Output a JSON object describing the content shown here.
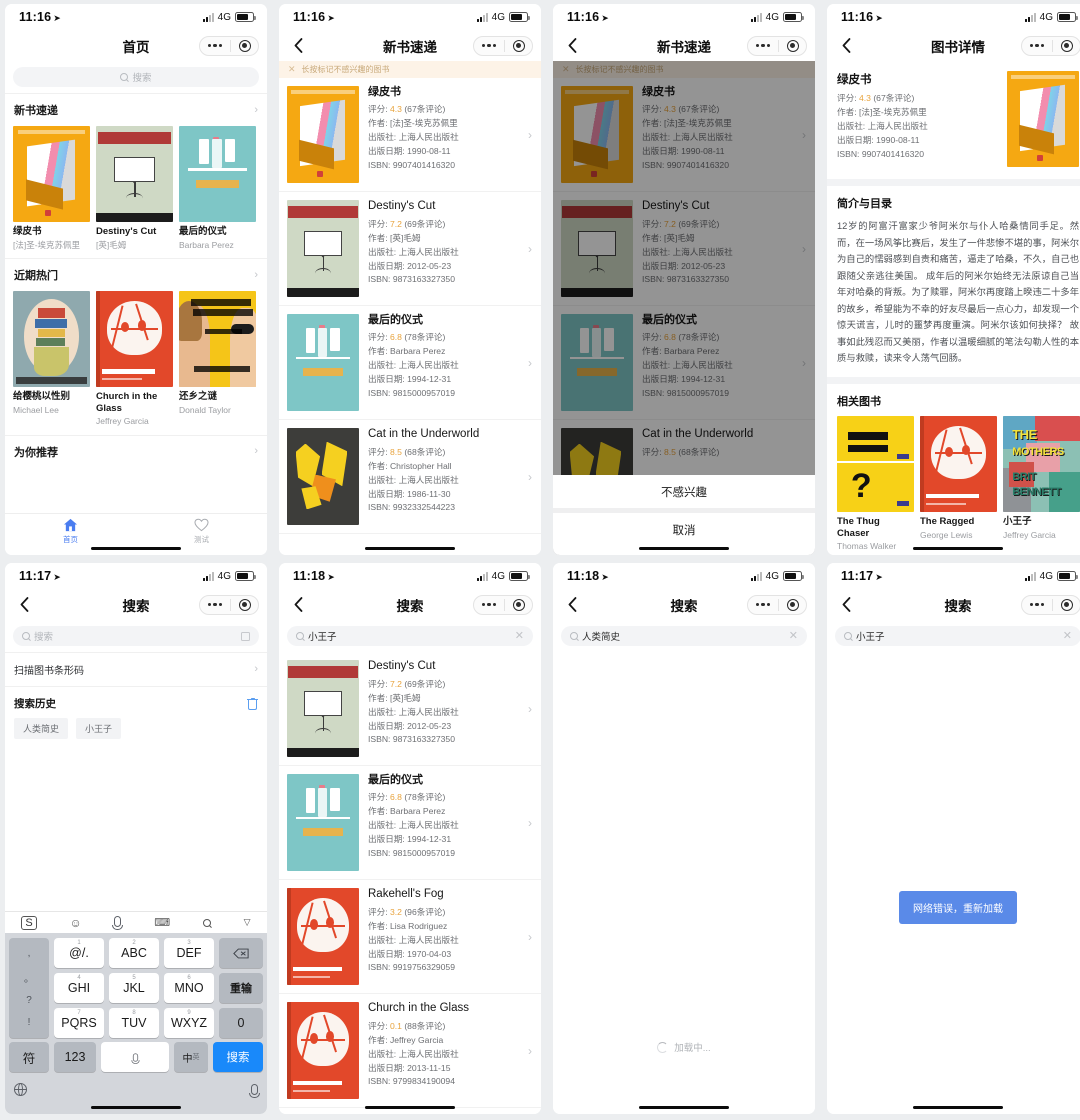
{
  "common": {
    "carrier_net": "4G",
    "nav_more_icon": "more-dots-icon",
    "nav_target_icon": "target-circle-icon",
    "back_icon": "back-chevron-icon",
    "chevron_right": "›",
    "publisher_label": "出版社:",
    "author_label": "作者:",
    "date_label": "出版日期:",
    "isbn_label": "ISBN:",
    "rating_label": "评分:",
    "accent_blue": "#1989fa",
    "rating_orange": "#e8a33d"
  },
  "panels": {
    "home": {
      "time": "11:16",
      "title": "首页",
      "search_placeholder": "搜索",
      "sections": [
        {
          "title": "新书速递"
        },
        {
          "title": "近期热门"
        },
        {
          "title": "为你推荐"
        }
      ],
      "new_books": [
        {
          "title": "绿皮书",
          "author": "[法]圣-埃克苏佩里",
          "cover": "cv-green"
        },
        {
          "title": "Destiny's Cut",
          "author": "[英]毛姆",
          "cover": "cv-destiny"
        },
        {
          "title": "最后的仪式",
          "author": "Barbara Perez",
          "cover": "cv-last"
        }
      ],
      "hot_books": [
        {
          "title": "给樱桃以性别",
          "author": "Michael Lee",
          "cover": "cv-cherry"
        },
        {
          "title": "Church in the Glass",
          "author": "Jeffrey Garcia",
          "cover": "cv-red"
        },
        {
          "title": "还乡之谜",
          "author": "Donald Taylor",
          "cover": "cv-conv"
        }
      ],
      "tabs": [
        {
          "label": "首页",
          "icon": "home-icon",
          "active": true
        },
        {
          "label": "测试",
          "icon": "heart-icon",
          "active": false
        }
      ]
    },
    "newlist": {
      "time": "11:16",
      "title": "新书速递",
      "tip": "长按标记不感兴趣的图书",
      "books": [
        {
          "title": "绿皮书",
          "en": false,
          "score": "4.3",
          "reviews": "(67条评论)",
          "author": "[法]圣-埃克苏佩里",
          "publisher": "上海人民出版社",
          "date": "1990-08-11",
          "isbn": "9907401416320",
          "cover": "cv-green"
        },
        {
          "title": "Destiny's Cut",
          "en": true,
          "score": "7.2",
          "reviews": "(69条评论)",
          "author": "[英]毛姆",
          "publisher": "上海人民出版社",
          "date": "2012-05-23",
          "isbn": "9873163327350",
          "cover": "cv-destiny"
        },
        {
          "title": "最后的仪式",
          "en": false,
          "score": "6.8",
          "reviews": "(78条评论)",
          "author": "Barbara Perez",
          "publisher": "上海人民出版社",
          "date": "1994-12-31",
          "isbn": "9815000957019",
          "cover": "cv-last"
        },
        {
          "title": "Cat in the Underworld",
          "en": true,
          "score": "8.5",
          "reviews": "(68条评论)",
          "author": "Christopher Hall",
          "publisher": "上海人民出版社",
          "date": "1986-11-30",
          "isbn": "9932332544223",
          "cover": "cv-cat"
        }
      ]
    },
    "sheet": {
      "time": "11:16",
      "title": "新书速递",
      "option": "不感兴趣",
      "cancel": "取消"
    },
    "detail": {
      "time": "11:16",
      "title": "图书详情",
      "book": {
        "title": "绿皮书",
        "score": "4.3",
        "reviews": "(67条评论)",
        "author": "[法]圣-埃克苏佩里",
        "publisher": "上海人民出版社",
        "date": "1990-08-11",
        "isbn": "9907401416320",
        "cover": "cv-green"
      },
      "desc_title": "简介与目录",
      "desc": "12岁的阿富汗富家少爷阿米尔与仆人哈桑情同手足。然而，在一场风筝比赛后，发生了一件悲惨不堪的事，阿米尔为自己的懦弱感到自责和痛苦，逼走了哈桑，不久，自己也跟随父亲逃往美国。 成年后的阿米尔始终无法原谅自己当年对哈桑的背叛。为了赎罪，阿米尔再度踏上暌违二十多年的故乡，希望能为不幸的好友尽最后一点心力，却发现一个惊天谎言，儿时的噩梦再度重演。阿米尔该如何抉择？ 故事如此残忍而又美丽，作者以温暖细腻的笔法勾勒人性的本质与救赎，读来令人荡气回肠。",
      "related_title": "相关图书",
      "related": [
        {
          "title": "The Thug Chaser",
          "author": "Thomas Walker",
          "cover": "cv-thug"
        },
        {
          "title": "The Ragged",
          "author": "George Lewis",
          "cover": "cv-red"
        },
        {
          "title": "小王子",
          "author": "Jeffrey Garcia",
          "cover": "cv-moth"
        }
      ]
    },
    "search_home": {
      "time": "11:17",
      "title": "搜索",
      "search_placeholder": "搜索",
      "scan_label": "扫描图书条形码",
      "history_title": "搜索历史",
      "history": [
        "人类简史",
        "小王子"
      ],
      "keyboard": {
        "toolbar_icons": [
          "sogou-logo-icon",
          "emoji-icon",
          "mic-icon",
          "keyboard-icon",
          "search-icon",
          "collapse-icon"
        ],
        "punct": [
          ",",
          "。",
          "?",
          "!"
        ],
        "keys": [
          {
            "num": "1",
            "label": "@/."
          },
          {
            "num": "2",
            "label": "ABC"
          },
          {
            "num": "3",
            "label": "DEF"
          },
          {
            "num": "4",
            "label": "GHI"
          },
          {
            "num": "5",
            "label": "JKL"
          },
          {
            "num": "6",
            "label": "MNO"
          },
          {
            "num": "7",
            "label": "PQRS"
          },
          {
            "num": "8",
            "label": "TUV"
          },
          {
            "num": "9",
            "label": "WXYZ"
          }
        ],
        "backspace": "backspace-icon",
        "redo": "重输",
        "zero": "0",
        "symbol": "符",
        "num_mode": "123",
        "space_icon": "space-mic-icon",
        "lang": "中",
        "lang_sub": "英",
        "send": "搜索",
        "globe": "globe-icon",
        "mic": "mic-icon"
      }
    },
    "search_results": {
      "time": "11:18",
      "title": "搜索",
      "query": "小王子",
      "books": [
        {
          "title": "Destiny's Cut",
          "en": true,
          "score": "7.2",
          "reviews": "(69条评论)",
          "author": "[英]毛姆",
          "publisher": "上海人民出版社",
          "date": "2012-05-23",
          "isbn": "9873163327350",
          "cover": "cv-destiny"
        },
        {
          "title": "最后的仪式",
          "en": false,
          "score": "6.8",
          "reviews": "(78条评论)",
          "author": "Barbara Perez",
          "publisher": "上海人民出版社",
          "date": "1994-12-31",
          "isbn": "9815000957019",
          "cover": "cv-last"
        },
        {
          "title": "Rakehell's Fog",
          "en": true,
          "score": "3.2",
          "reviews": "(96条评论)",
          "author": "Lisa Rodriguez",
          "publisher": "上海人民出版社",
          "date": "1970-04-03",
          "isbn": "9919756329059",
          "cover": "cv-red"
        },
        {
          "title": "Church in the Glass",
          "en": true,
          "score": "0.1",
          "reviews": "(88条评论)",
          "author": "Jeffrey Garcia",
          "publisher": "上海人民出版社",
          "date": "2013-11-15",
          "isbn": "9799834190094",
          "cover": "cv-red"
        }
      ]
    },
    "search_loading": {
      "time": "11:18",
      "title": "搜索",
      "query": "人类简史",
      "loading_text": "加载中..."
    },
    "search_error": {
      "time": "11:17",
      "title": "搜索",
      "query": "小王子",
      "error_button": "网络错误，重新加载"
    }
  }
}
